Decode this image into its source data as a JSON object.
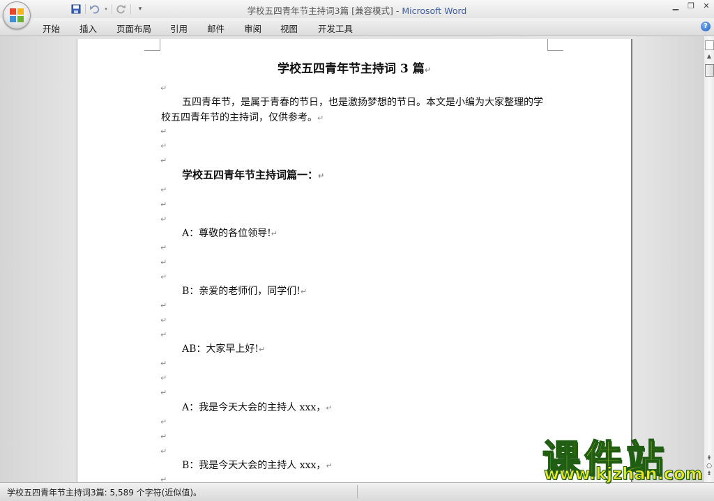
{
  "window": {
    "title_doc": "学校五四青年节主持词3篇 [兼容模式]",
    "title_sep": " - ",
    "title_app": "Microsoft Word"
  },
  "ribbon": {
    "tabs": [
      "开始",
      "插入",
      "页面布局",
      "引用",
      "邮件",
      "审阅",
      "视图",
      "开发工具"
    ]
  },
  "document": {
    "title": "学校五四青年节主持词 3 篇",
    "intro_line1": "五四青年节，是属于青春的节日，也是激扬梦想的节日。本文是小编为大家整理的学",
    "intro_line2": "校五四青年节的主持词，仅供参考。",
    "section_heading": "学校五四青年节主持词篇一：",
    "lines": [
      "A：尊敬的各位领导!",
      "B：亲爱的老师们，同学们!",
      "AB：大家早上好!",
      "A：我是今天大会的主持人 xxx，",
      "B：我是今天大会的主持人 xxx，"
    ],
    "paragraph_mark": "↵"
  },
  "status": {
    "text": "学校五四青年节主持词3篇: 5,589 个字符(近似值)。"
  },
  "watermark": {
    "title": "课件站",
    "url": "www.kjzhan.com"
  }
}
